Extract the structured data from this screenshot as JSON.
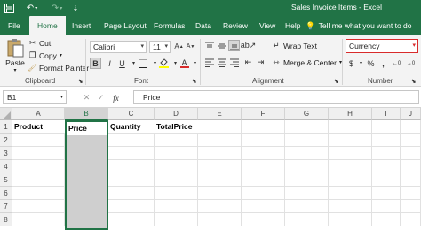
{
  "window": {
    "title": "Sales Invoice Items  -  Excel",
    "qat": [
      "save-icon",
      "undo-icon",
      "redo-icon",
      "customize-qat-icon"
    ]
  },
  "tabs": [
    "File",
    "Home",
    "Insert",
    "Page Layout",
    "Formulas",
    "Data",
    "Review",
    "View",
    "Help"
  ],
  "active_tab": "Home",
  "tell_me": "Tell me what you want to do",
  "ribbon": {
    "clipboard": {
      "paste": "Paste",
      "cut": "Cut",
      "copy": "Copy",
      "format_painter": "Format Painter",
      "label": "Clipboard"
    },
    "font": {
      "name": "Calibri",
      "size": "11",
      "bold": "B",
      "italic": "I",
      "underline": "U",
      "label": "Font"
    },
    "alignment": {
      "wrap_text": "Wrap Text",
      "merge_center": "Merge & Center",
      "label": "Alignment"
    },
    "number": {
      "format": "Currency",
      "currency_symbol": "$",
      "percent": "%",
      "comma": ",",
      "label": "Number"
    }
  },
  "formula_bar": {
    "name_box": "B1",
    "cancel": "✕",
    "enter": "✓",
    "fx": "fx",
    "content": "Price"
  },
  "sheet": {
    "columns": [
      "A",
      "B",
      "C",
      "D",
      "E",
      "F",
      "G",
      "H",
      "I",
      "J"
    ],
    "selected_column": "B",
    "rows": [
      "1",
      "2",
      "3",
      "4",
      "5",
      "6",
      "7",
      "8"
    ],
    "row1": [
      "Product",
      "Price",
      "Quantity",
      "TotalPrice"
    ]
  },
  "colors": {
    "accent": "#217346",
    "ribbon_bg": "#f3f3f3",
    "selection": "#cfcfcf",
    "number_format_border": "#d82b2b"
  }
}
